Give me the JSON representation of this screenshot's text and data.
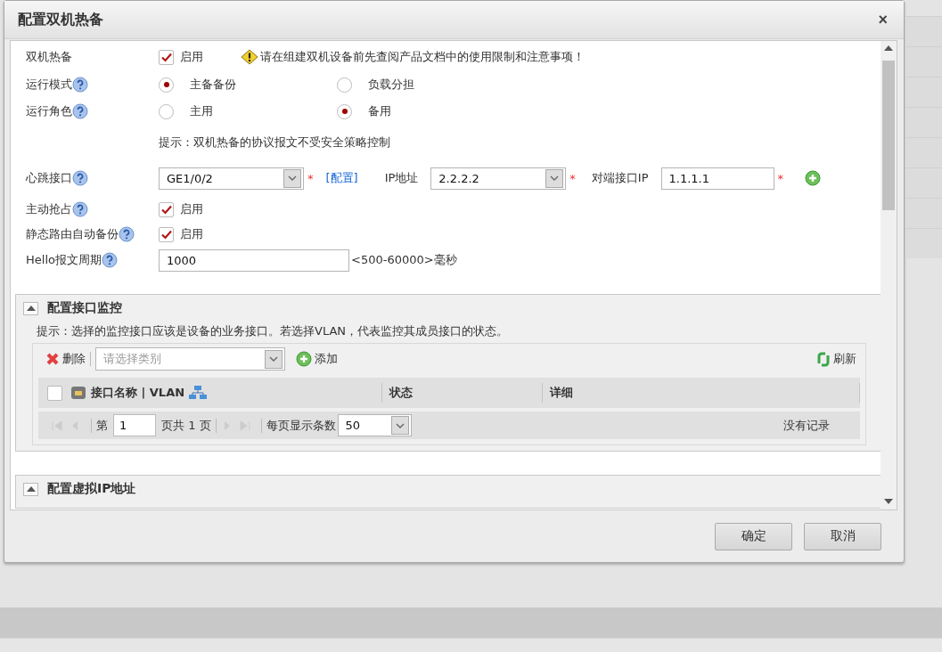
{
  "dialog": {
    "title": "配置双机热备",
    "close": "×"
  },
  "rows": [
    {
      "kind": "checkbox",
      "label": "双机热备",
      "help": false,
      "checked": true,
      "option": "启用",
      "note": "请在组建双机设备前先查阅产品文档中的使用限制和注意事项！"
    },
    {
      "kind": "radio",
      "label": "运行模式",
      "help": true,
      "options": [
        {
          "label": "主备备份",
          "selected": true
        },
        {
          "label": "负载分担",
          "selected": false
        }
      ]
    },
    {
      "kind": "radio",
      "label": "运行角色",
      "help": true,
      "options": [
        {
          "label": "主用",
          "selected": false
        },
        {
          "label": "备用",
          "selected": true
        }
      ]
    },
    {
      "kind": "hint",
      "text": "提示：双机热备的协议报文不受安全策略控制"
    },
    {
      "kind": "heartbeat",
      "label": "心跳接口",
      "help": true,
      "interface": {
        "value": "GE1/0/2",
        "required": "*"
      },
      "config_link": "[配置]",
      "ip_label": "IP地址",
      "ip": {
        "value": "2.2.2.2",
        "required": "*"
      },
      "peer_label": "对端接口IP",
      "peer_ip": {
        "value": "1.1.1.1",
        "required": "*"
      }
    },
    {
      "kind": "checkbox",
      "label": "主动抢占",
      "help": true,
      "checked": true,
      "option": "启用"
    },
    {
      "kind": "checkbox",
      "label": "静态路由自动备份",
      "help": true,
      "checked": true,
      "option": "启用"
    },
    {
      "kind": "number",
      "label": "Hello报文周期",
      "help": true,
      "value": "1000",
      "unit": "<500-60000>毫秒"
    }
  ],
  "sections": [
    {
      "title": "配置接口监控",
      "expanded": true,
      "hint": "提示：选择的监控接口应该是设备的业务接口。若选择VLAN，代表监控其成员接口的状态。",
      "toolbar": {
        "delete": "删除",
        "category_placeholder": "请选择类别",
        "add": "添加",
        "refresh": "刷新"
      },
      "table": {
        "select_all_checked": false,
        "columns": [
          "接口名称 | VLAN",
          "状态",
          "详细"
        ]
      },
      "pager": {
        "page_prefix": "第",
        "page": "1",
        "page_suffix": "页共 1 页",
        "page_size_label": "每页显示条数",
        "page_size": "50",
        "empty": "没有记录"
      }
    },
    {
      "title": "配置虚拟IP地址",
      "expanded": true
    }
  ],
  "buttons": [
    "确定",
    "取消"
  ]
}
